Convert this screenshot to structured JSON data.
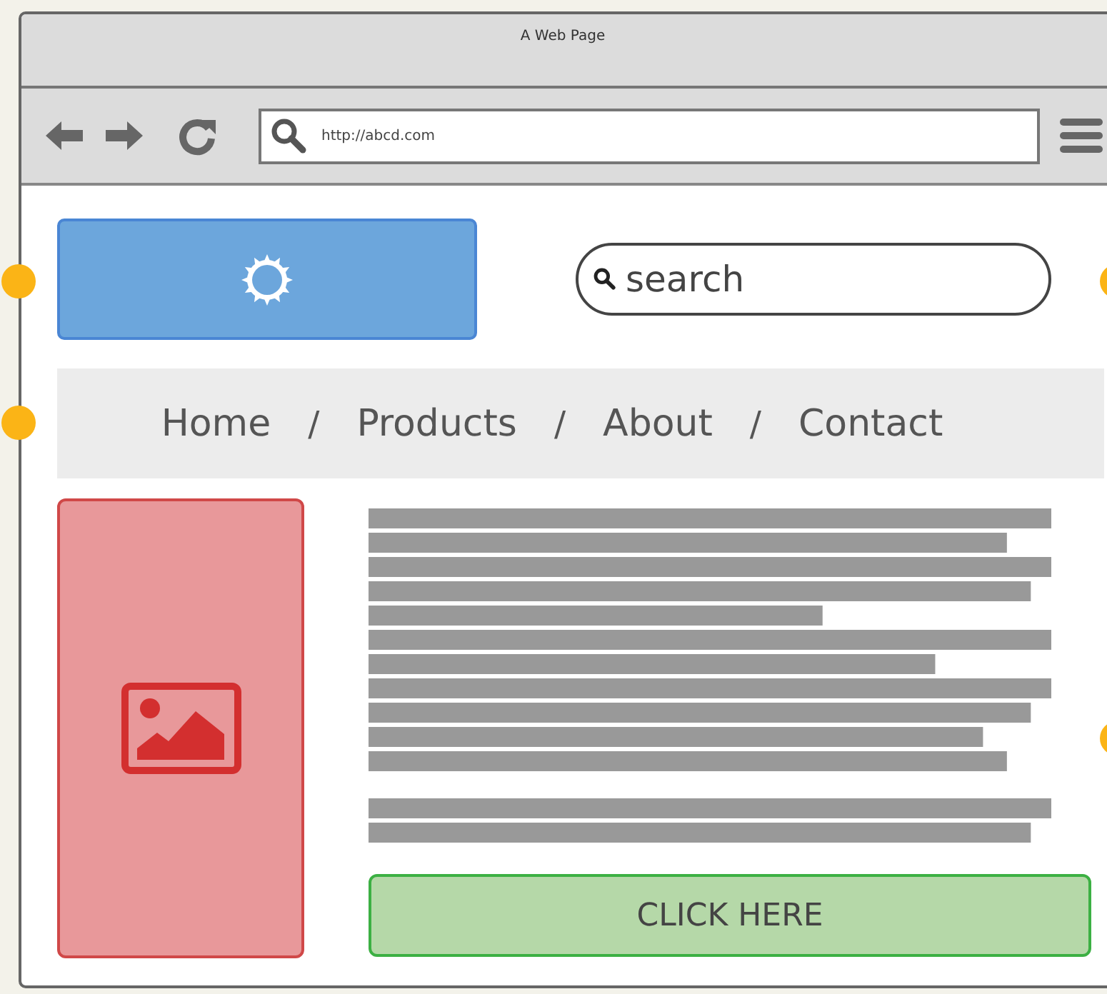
{
  "window": {
    "title": "A Web Page"
  },
  "toolbar": {
    "url": "http://abcd.com"
  },
  "search": {
    "placeholder": "search"
  },
  "nav": [
    {
      "kind": "link",
      "label": "Home"
    },
    {
      "kind": "separator",
      "label": "/"
    },
    {
      "kind": "link",
      "label": "Products"
    },
    {
      "kind": "separator",
      "label": "/"
    },
    {
      "kind": "link",
      "label": "About"
    },
    {
      "kind": "separator",
      "label": "/"
    },
    {
      "kind": "link",
      "label": "Contact"
    }
  ],
  "button": {
    "label": "CLICK HERE"
  }
}
